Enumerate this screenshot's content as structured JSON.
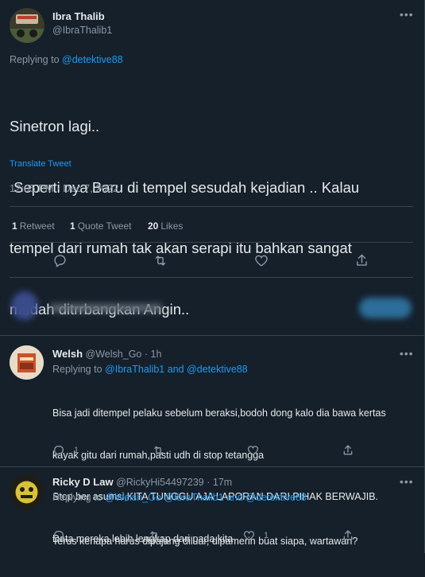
{
  "main_tweet": {
    "author_name": "Ibra Thalib",
    "author_handle": "@IbraThalib1",
    "replying_prefix": "Replying to",
    "replying_to": "@detektive88",
    "text_lines": [
      "Sinetron lagi..",
      " Seperti nya Baru di tempel sesudah kejadian .. Kalau",
      "tempel dari rumah tak akan serapi itu bahkan sangat",
      "mudah ditrrbangkan Angin.."
    ],
    "translate_label": "Translate Tweet",
    "timestamp": "12:05 PM · Dec 7, 2022",
    "stats": {
      "retweets_count": "1",
      "retweets_label": "Retweet",
      "quotes_count": "1",
      "quotes_label": "Quote Tweet",
      "likes_count": "20",
      "likes_label": "Likes"
    },
    "more_icon": "more-dots-icon",
    "colors": {
      "background": "#15202b",
      "link": "#1d9bf0",
      "muted": "#8b98a5"
    }
  },
  "replies": [
    {
      "author_name": "Welsh",
      "author_handle": "@Welsh_Go",
      "time": "· 1h",
      "replying_prefix": "Replying to",
      "replying_to_1": "@IbraThalib1",
      "and": "and",
      "replying_to_2": "@detektive88",
      "text_lines": [
        "Bisa jadi ditempel pelaku sebelum beraksi,bodoh dong kalo dia bawa kertas",
        "kayak gitu dari rumah,pasti udh di stop tetangga",
        "Stop ber asumsi,KITA TUNGGU AJA LAPORAN DARI PIHAK BERWAJIB.",
        "Data mereka lebih lengkap dari pada kita"
      ],
      "reply_count": "1",
      "retweet_count": "",
      "like_count": ""
    },
    {
      "author_name": "Ricky D Law",
      "author_handle": "@RickyHi54497239",
      "time": "· 17m",
      "replying_prefix": "Replying to",
      "replying_to_1": "@Welsh_Go",
      "replying_to_2": "@IbraThalib1",
      "and": "and",
      "replying_to_3": "@detektive88",
      "text_lines": [
        "Terus kenapa harus dipajang diluar, dipamerin buat siapa, wartawan?"
      ],
      "reply_count": "",
      "retweet_count": "",
      "like_count": "1"
    }
  ]
}
